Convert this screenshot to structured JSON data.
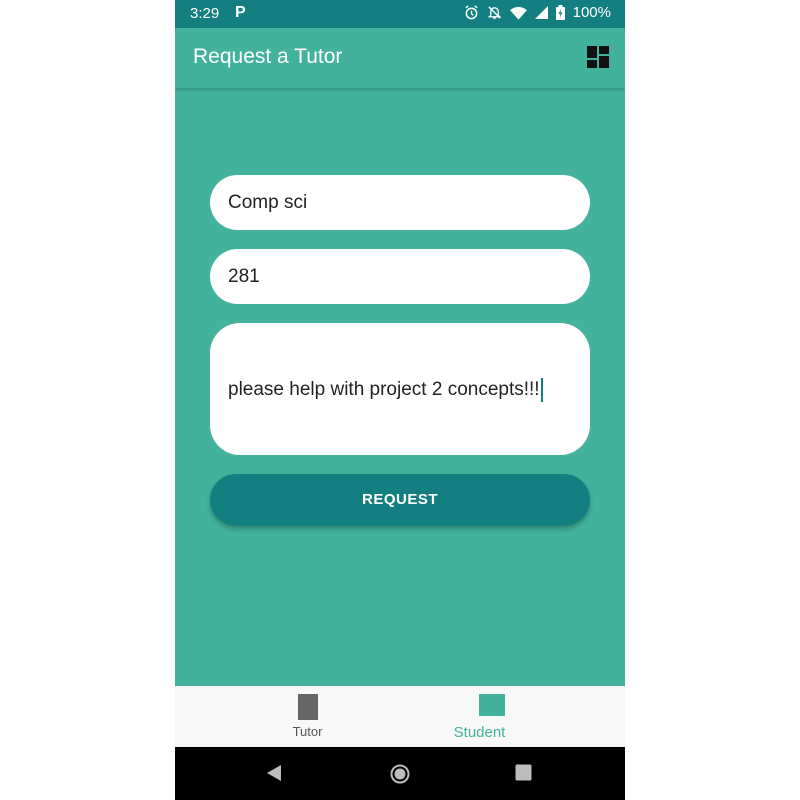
{
  "status_bar": {
    "time": "3:29",
    "p_icon": "P",
    "battery": "100%",
    "icons": [
      "alarm-icon",
      "notifications-off-icon",
      "wifi-icon",
      "signal-icon",
      "battery-icon"
    ]
  },
  "app_bar": {
    "title": "Request a Tutor",
    "menu_icon": "dashboard-icon"
  },
  "form": {
    "course_value": "Comp sci",
    "number_value": "281",
    "description_value": "please help with project 2 concepts!!!",
    "request_label": "REQUEST"
  },
  "bottom_nav": {
    "items": [
      {
        "label": "Tutor",
        "icon": "tutor-icon",
        "selected": false
      },
      {
        "label": "Student",
        "icon": "student-icon",
        "selected": true
      }
    ]
  },
  "system_nav": {
    "buttons": [
      "back-icon",
      "home-icon",
      "recents-icon"
    ]
  },
  "colors": {
    "primary": "#43b29d",
    "primary_dark": "#137f80",
    "field_bg": "#ffffff",
    "nav_bg": "#f8f8f8",
    "system_nav_bg": "#000000"
  }
}
